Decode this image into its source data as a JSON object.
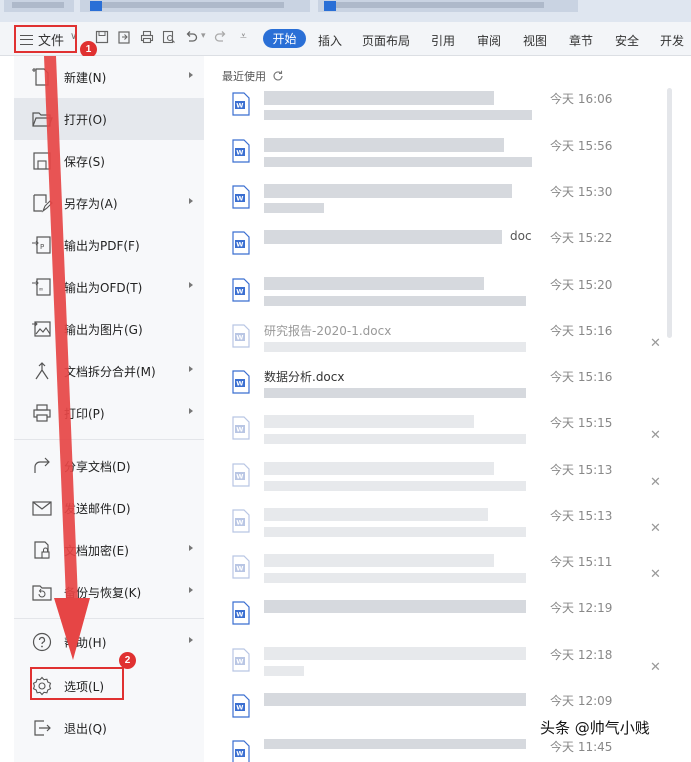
{
  "toolbar": {
    "file_label": "文件",
    "start_label": "开始",
    "tabs": [
      "插入",
      "页面布局",
      "引用",
      "审阅",
      "视图",
      "章节",
      "安全",
      "开发"
    ]
  },
  "annotations": {
    "step1": "1",
    "step2": "2"
  },
  "file_menu": {
    "items": [
      {
        "label": "新建(N)",
        "icon": "new-file-icon",
        "has_submenu": true
      },
      {
        "label": "打开(O)",
        "icon": "folder-open-icon",
        "has_submenu": false,
        "active": true
      },
      {
        "label": "保存(S)",
        "icon": "save-icon",
        "has_submenu": false
      },
      {
        "label": "另存为(A)",
        "icon": "save-as-icon",
        "has_submenu": true
      },
      {
        "label": "输出为PDF(F)",
        "icon": "pdf-export-icon",
        "has_submenu": false
      },
      {
        "label": "输出为OFD(T)",
        "icon": "ofd-export-icon",
        "has_submenu": true
      },
      {
        "label": "输出为图片(G)",
        "icon": "image-export-icon",
        "has_submenu": false
      },
      {
        "label": "文档拆分合并(M)",
        "icon": "split-merge-icon",
        "has_submenu": true
      },
      {
        "label": "打印(P)",
        "icon": "print-icon",
        "has_submenu": true
      },
      {
        "label": "分享文档(D)",
        "icon": "share-icon",
        "has_submenu": false
      },
      {
        "label": "发送邮件(D)",
        "icon": "mail-icon",
        "has_submenu": false
      },
      {
        "label": "文档加密(E)",
        "icon": "encrypt-icon",
        "has_submenu": true
      },
      {
        "label": "备份与恢复(K)",
        "icon": "backup-icon",
        "has_submenu": true
      },
      {
        "label": "帮助(H)",
        "icon": "help-icon",
        "has_submenu": true
      },
      {
        "label": "选项(L)",
        "icon": "gear-icon",
        "has_submenu": false
      },
      {
        "label": "退出(Q)",
        "icon": "exit-icon",
        "has_submenu": false
      }
    ]
  },
  "recent": {
    "title": "最近使用",
    "files": [
      {
        "name": "",
        "time": "今天 16:06",
        "closable": false
      },
      {
        "name": "",
        "time": "今天 15:56",
        "closable": false
      },
      {
        "name": "",
        "time": "今天 15:30",
        "closable": false
      },
      {
        "name": "",
        "time": "今天 15:22",
        "closable": false
      },
      {
        "name": "",
        "time": "今天 15:20",
        "closable": false
      },
      {
        "name": "研究报告-2020-1.docx",
        "time": "今天 15:16",
        "closable": true
      },
      {
        "name": "数据分析.docx",
        "time": "今天 15:16",
        "closable": false
      },
      {
        "name": "",
        "time": "今天 15:15",
        "closable": true
      },
      {
        "name": "",
        "time": "今天 15:13",
        "closable": true
      },
      {
        "name": "",
        "time": "今天 15:13",
        "closable": true
      },
      {
        "name": "",
        "time": "今天 15:11",
        "closable": true
      },
      {
        "name": "",
        "time": "今天 12:19",
        "closable": false
      },
      {
        "name": "",
        "time": "今天 12:18",
        "closable": true
      },
      {
        "name": "",
        "time": "今天 12:09",
        "closable": false
      },
      {
        "name": "",
        "time": "今天 11:45",
        "closable": false
      }
    ]
  },
  "watermark": "头条 @帅气小贱",
  "colors": {
    "accent": "#2a6fd6",
    "annotation": "#e03131",
    "word_icon": "#3b6fd1"
  }
}
